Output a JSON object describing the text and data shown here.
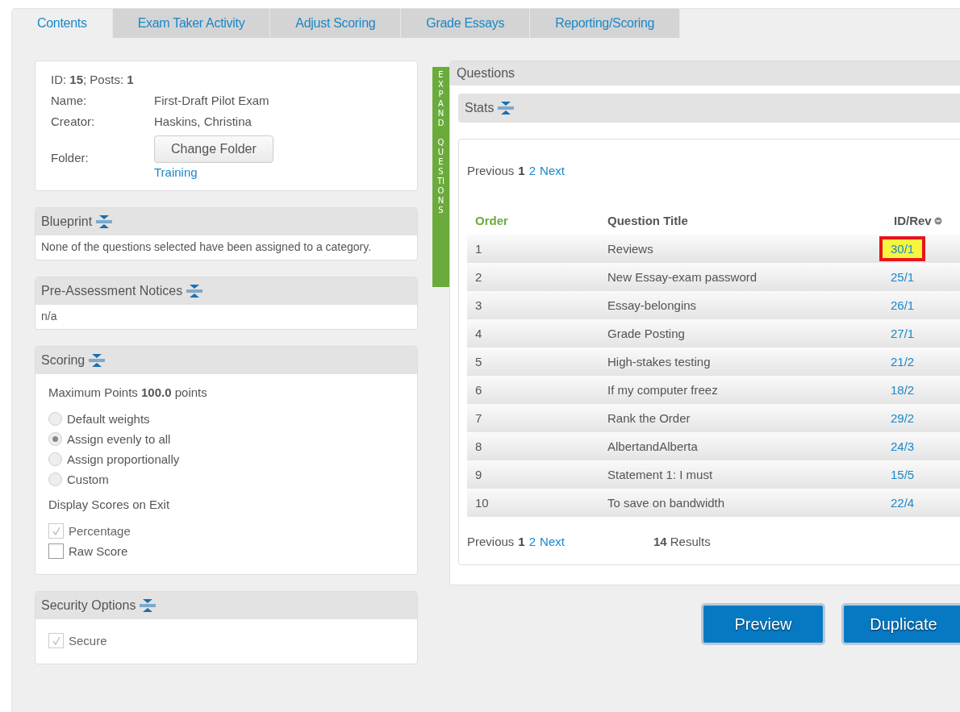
{
  "tabs": [
    {
      "label": "Contents",
      "selected": true
    },
    {
      "label": "Exam Taker Activity",
      "selected": false
    },
    {
      "label": "Adjust Scoring",
      "selected": false
    },
    {
      "label": "Grade Essays",
      "selected": false
    },
    {
      "label": "Reporting/Scoring",
      "selected": false
    }
  ],
  "info": {
    "summary": "ID: **15**; Posts: **1**",
    "fields": [
      {
        "label": "Name:",
        "value": "First-Draft Pilot Exam"
      },
      {
        "label": "Creator:",
        "value": "Haskins, Christina"
      }
    ],
    "folder_label": "Folder:",
    "folder_button": "Change Folder",
    "folder_link": "Training"
  },
  "blueprint": {
    "title": "Blueprint",
    "text": "None of the questions selected have been assigned to a category."
  },
  "notices": {
    "title": "Pre-Assessment Notices",
    "text": "n/a"
  },
  "scoring": {
    "title": "Scoring",
    "max_points": "Maximum Points **100.0** points",
    "weights": [
      {
        "label": "Default weights",
        "selected": false
      },
      {
        "label": "Assign evenly to all",
        "selected": true
      },
      {
        "label": "Assign proportionally",
        "selected": false
      },
      {
        "label": "Custom",
        "selected": false
      }
    ],
    "display_label": "Display Scores on Exit",
    "display_options": [
      {
        "label": "Percentage",
        "checked": true,
        "disabled": true
      },
      {
        "label": "Raw Score",
        "checked": false,
        "disabled": false
      }
    ]
  },
  "security": {
    "title": "Security Options",
    "options": [
      {
        "label": "Secure",
        "checked": true,
        "disabled": true
      }
    ]
  },
  "expand_tab": "EXPAND QUESTIONS",
  "questions": {
    "title": "Questions",
    "stats_title": "Stats",
    "pager": {
      "previous": "Previous",
      "pages": [
        {
          "label": "1",
          "selected": true
        },
        {
          "label": "2",
          "selected": false
        }
      ],
      "next": "Next"
    },
    "bottom_pager": {
      "previous": "Previous",
      "pages": [
        {
          "label": "1",
          "selected": true
        },
        {
          "label": "2",
          "selected": false
        }
      ],
      "next": "Next"
    },
    "results": "**14** Results",
    "columns": [
      "Order",
      "Question Title",
      "ID/Rev"
    ],
    "rows": [
      {
        "order": "1",
        "title": "Reviews",
        "id_rev": "30/1",
        "highlighted": true
      },
      {
        "order": "2",
        "title": "New Essay-exam password",
        "id_rev": "25/1",
        "highlighted": false
      },
      {
        "order": "3",
        "title": "Essay-belongins",
        "id_rev": "26/1",
        "highlighted": false
      },
      {
        "order": "4",
        "title": "Grade Posting",
        "id_rev": "27/1",
        "highlighted": false
      },
      {
        "order": "5",
        "title": "High-stakes testing",
        "id_rev": "21/2",
        "highlighted": false
      },
      {
        "order": "6",
        "title": "If my computer freez",
        "id_rev": "18/2",
        "highlighted": false
      },
      {
        "order": "7",
        "title": "Rank the Order",
        "id_rev": "29/2",
        "highlighted": false
      },
      {
        "order": "8",
        "title": "AlbertandAlberta",
        "id_rev": "24/3",
        "highlighted": false
      },
      {
        "order": "9",
        "title": "Statement 1: I must",
        "id_rev": "15/5",
        "highlighted": false
      },
      {
        "order": "10",
        "title": "To save on bandwidth",
        "id_rev": "22/4",
        "highlighted": false
      }
    ]
  },
  "buttons": [
    "Preview",
    "Duplicate"
  ]
}
